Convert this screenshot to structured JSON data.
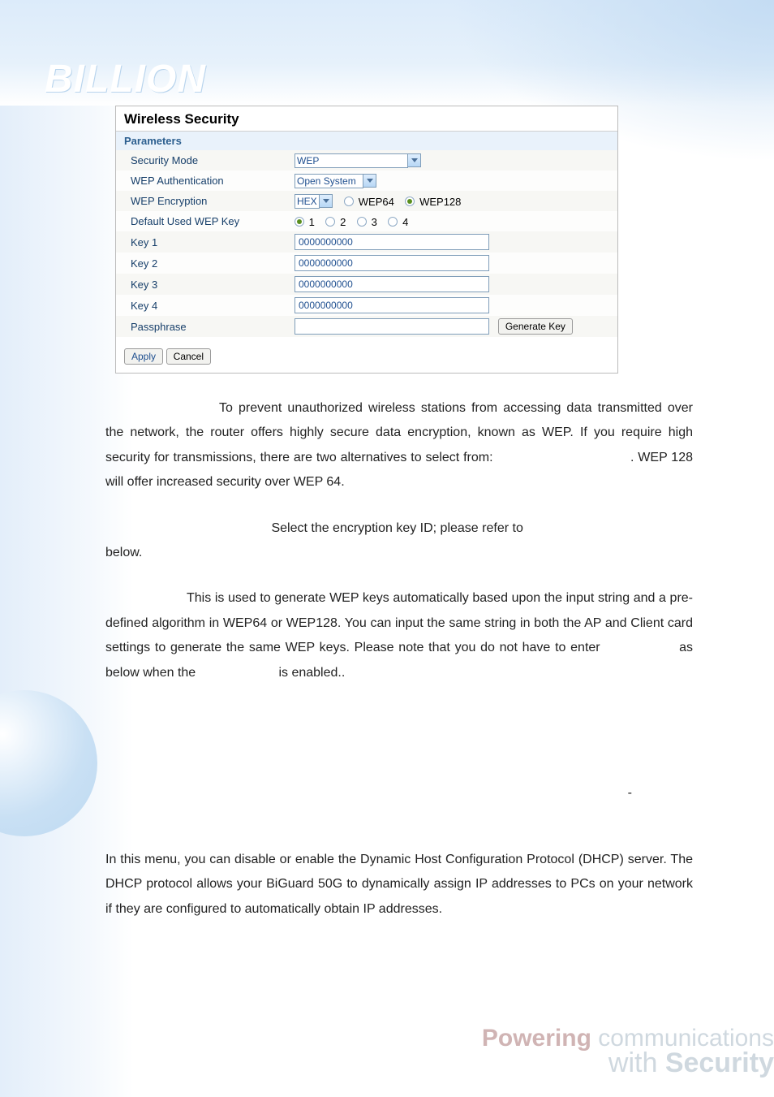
{
  "logo": "BILLION",
  "panel": {
    "title": "Wireless Security",
    "subheader": "Parameters",
    "securityMode": {
      "label": "Security Mode",
      "value": "WEP"
    },
    "wepAuth": {
      "label": "WEP Authentication",
      "value": "Open System"
    },
    "wepEnc": {
      "label": "WEP Encryption",
      "format": "HEX",
      "opt1": "WEP64",
      "opt2": "WEP128"
    },
    "defaultKey": {
      "label": "Default Used WEP Key",
      "o1": "1",
      "o2": "2",
      "o3": "3",
      "o4": "4"
    },
    "key1": {
      "label": "Key 1",
      "value": "0000000000"
    },
    "key2": {
      "label": "Key 2",
      "value": "0000000000"
    },
    "key3": {
      "label": "Key 3",
      "value": "0000000000"
    },
    "key4": {
      "label": "Key 4",
      "value": "0000000000"
    },
    "passphrase": {
      "label": "Passphrase",
      "value": "",
      "button": "Generate Key"
    },
    "apply": "Apply",
    "cancel": "Cancel"
  },
  "doc": {
    "p1a": "To prevent unauthorized wireless stations from accessing data transmitted over the network, the router offers highly secure data encryption, known as WEP. If you require high security for transmissions, there are two alternatives to select from:",
    "p1b": ". WEP 128 will offer increased security over WEP 64.",
    "p2a": "Select the encryption key ID; please refer to",
    "p2b": "below.",
    "p3a": "This is used to generate WEP keys automatically based upon the input string and a pre-defined algorithm in WEP64 or WEP128. You can input the same string in both the AP and Client card settings to generate the same WEP keys. Please note that you do not have to enter",
    "p3b": "as below when the",
    "p3c": "is enabled..",
    "dash": "-",
    "p4": "In this menu, you can disable or enable the Dynamic Host Configuration Protocol (DHCP) server. The DHCP protocol allows your BiGuard 50G to dynamically assign IP addresses to PCs on your network if they are configured to automatically obtain IP addresses."
  },
  "tagline": {
    "powering": "Powering",
    "comm": " communications",
    "with": "with ",
    "security": "Security"
  }
}
